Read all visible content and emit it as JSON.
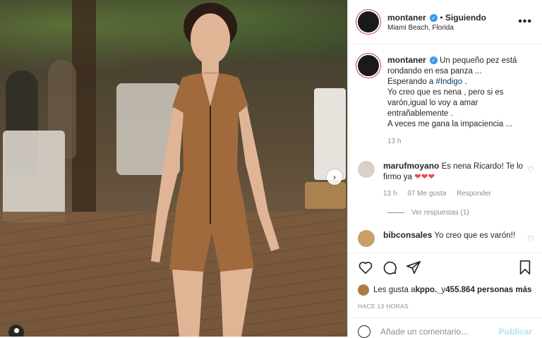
{
  "header": {
    "username": "montaner",
    "separator": "•",
    "follow_label": "Siguiendo",
    "location": "Miami Beach, Florida",
    "more_label": "•••"
  },
  "caption": {
    "username": "montaner",
    "line1_prefix": "Un pequeño pez está rondando en esa panza ...",
    "line2_prefix": "Esperando a ",
    "hashtag": "#Indigo",
    "line2_suffix": " .",
    "line3": "Yo creo que es nena , pero si es varón,igual lo voy a amar entrañablemente .",
    "line4": "A veces me gana la impaciencia ...",
    "time": "13 h"
  },
  "comments": [
    {
      "username": "marufmoyano",
      "text": "Es nena Ricardo! Te lo firmo ya",
      "hearts": "❤❤❤",
      "time": "13 h",
      "likes": "97 Me gusta",
      "reply_label": "Responder",
      "view_replies": "Ver respuestas (1)"
    },
    {
      "username": "bibconsales",
      "text": "Yo creo que es varón!!"
    }
  ],
  "likes": {
    "prefix": "Les gusta a ",
    "user": "kppo._",
    "middle": " y ",
    "count": "455.864 personas más"
  },
  "post_date": "HACE 13 HORAS",
  "add_comment": {
    "placeholder": "Añade un comentario...",
    "post_label": "Publicar"
  },
  "colors": {
    "verified": "#3897f0",
    "hashtag": "#00376b",
    "hearts": "#ed4956",
    "publish_disabled": "#b2dffc"
  }
}
